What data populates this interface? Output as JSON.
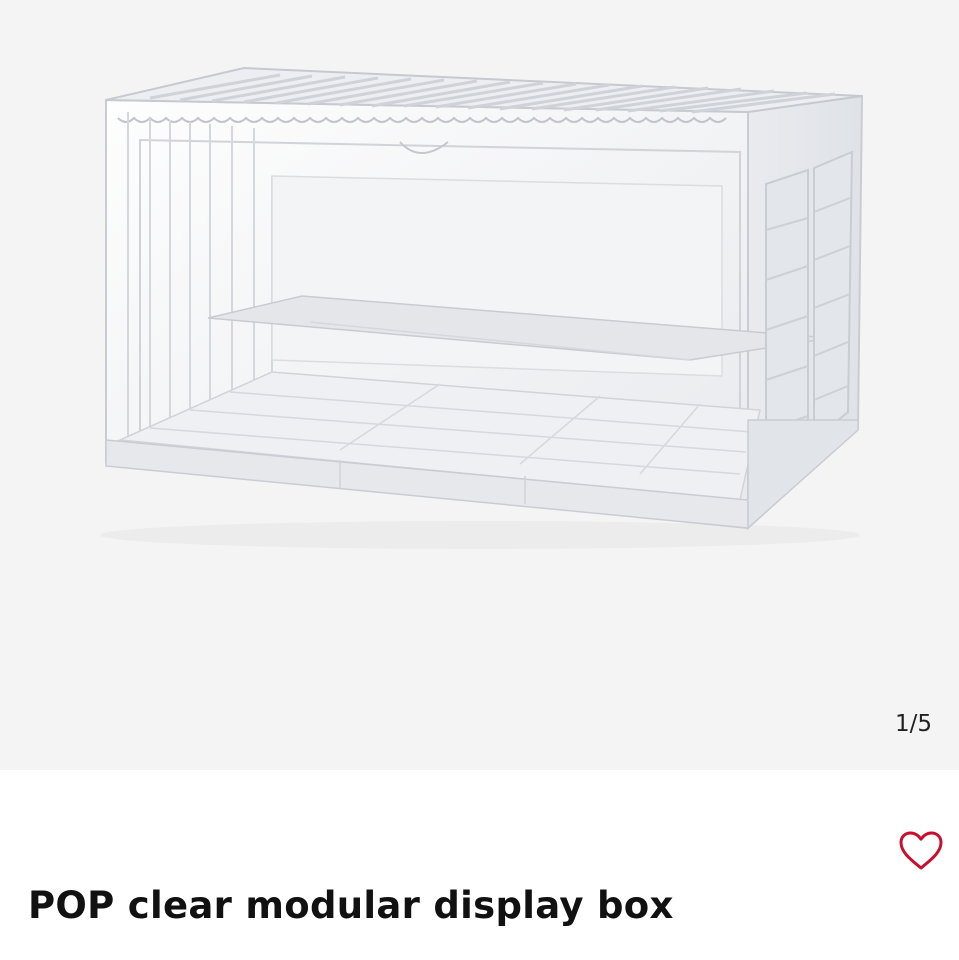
{
  "gallery": {
    "counter": "1/5",
    "current_index": 1,
    "total": 5
  },
  "product": {
    "title": "POP clear modular display box",
    "favorite_icon": "heart-outline-icon",
    "favorited": false
  },
  "colors": {
    "gallery_background": "#f4f4f4",
    "page_background": "#ffffff",
    "title_text": "#111111",
    "favorite_accent": "#c8102e"
  }
}
